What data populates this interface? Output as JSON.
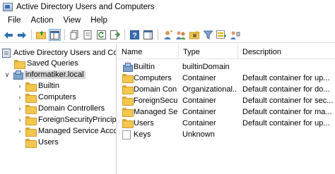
{
  "window": {
    "title": "Active Directory Users and Computers"
  },
  "menu": [
    "File",
    "Action",
    "View",
    "Help"
  ],
  "toolbar": {
    "buttons": [
      "back-icon",
      "forward-icon",
      "up-folder-icon",
      "console-tree-icon",
      "copy-icon",
      "properties-icon",
      "refresh-icon",
      "export-list-icon",
      "help-icon",
      "show-pane-icon",
      "new-user-icon",
      "new-group-icon",
      "new-ou-icon",
      "filter-icon",
      "add-to-group-icon",
      "delegate-icon"
    ]
  },
  "tree": {
    "root": "Active Directory Users and Com",
    "saved_queries": "Saved Queries",
    "domain": "informatiker.local",
    "children": [
      "Builtin",
      "Computers",
      "Domain Controllers",
      "ForeignSecurityPrincipals",
      "Managed Service Accour",
      "Users"
    ]
  },
  "list": {
    "columns": [
      "Name",
      "Type",
      "Description"
    ],
    "rows": [
      {
        "name": "Builtin",
        "type": "builtinDomain",
        "description": "",
        "icon": "domain-icon"
      },
      {
        "name": "Computers",
        "type": "Container",
        "description": "Default container for up...",
        "icon": "folder-icon"
      },
      {
        "name": "Domain Con...",
        "type": "Organizational...",
        "description": "Default container for do...",
        "icon": "ou-folder-icon"
      },
      {
        "name": "ForeignSecu...",
        "type": "Container",
        "description": "Default container for sec...",
        "icon": "folder-icon"
      },
      {
        "name": "Managed Se...",
        "type": "Container",
        "description": "Default container for ma...",
        "icon": "folder-icon"
      },
      {
        "name": "Users",
        "type": "Container",
        "description": "Default container for up...",
        "icon": "folder-icon"
      },
      {
        "name": "Keys",
        "type": "Unknown",
        "description": "",
        "icon": "keys-icon"
      }
    ]
  },
  "colors": {
    "folder": "#f3c74d",
    "selection": "#d9d9d9",
    "accent": "#3c6fb3"
  }
}
